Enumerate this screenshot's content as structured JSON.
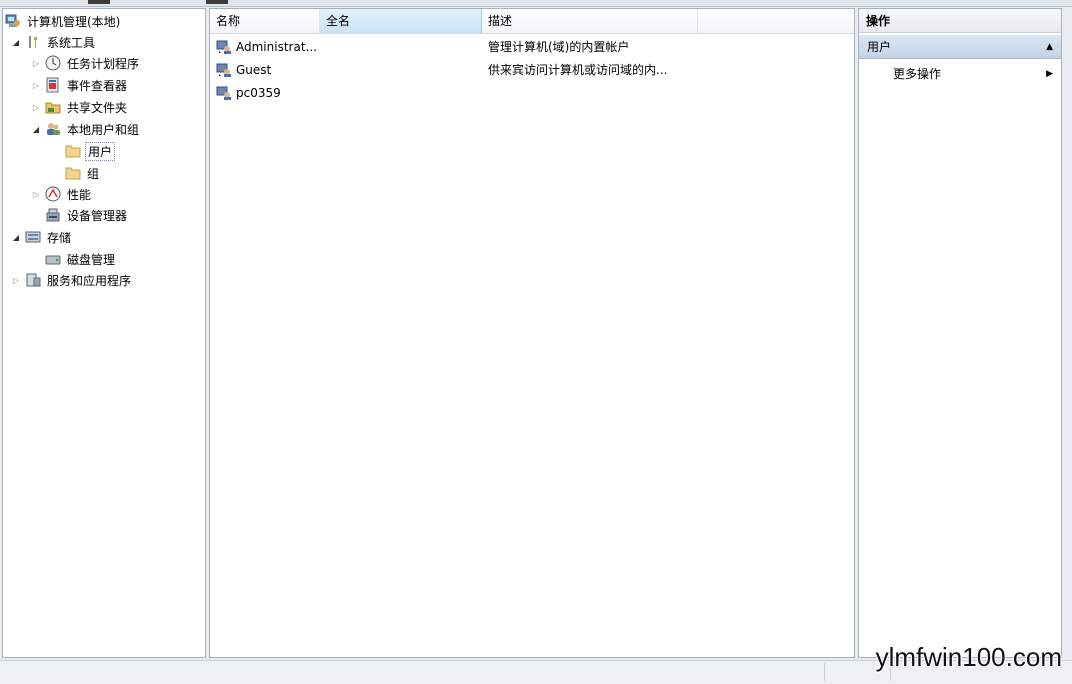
{
  "tree": {
    "root": "计算机管理(本地)",
    "system_tools": "系统工具",
    "task_scheduler": "任务计划程序",
    "event_viewer": "事件查看器",
    "shared_folders": "共享文件夹",
    "local_users_groups": "本地用户和组",
    "users": "用户",
    "groups": "组",
    "performance": "性能",
    "device_manager": "设备管理器",
    "storage": "存储",
    "disk_management": "磁盘管理",
    "services_apps": "服务和应用程序"
  },
  "list": {
    "columns": {
      "name": "名称",
      "fullname": "全名",
      "description": "描述"
    },
    "rows": [
      {
        "name": "Administrat...",
        "fullname": "",
        "description": "管理计算机(域)的内置帐户"
      },
      {
        "name": "Guest",
        "fullname": "",
        "description": "供来宾访问计算机或访问域的内..."
      },
      {
        "name": "pc0359",
        "fullname": "",
        "description": ""
      }
    ]
  },
  "actions": {
    "title": "操作",
    "section": "用户",
    "more": "更多操作"
  },
  "watermark": "ylmfwin100.com",
  "colors": {
    "selection_header": "#c9e3f6",
    "action_section": "#c3d3e7"
  }
}
